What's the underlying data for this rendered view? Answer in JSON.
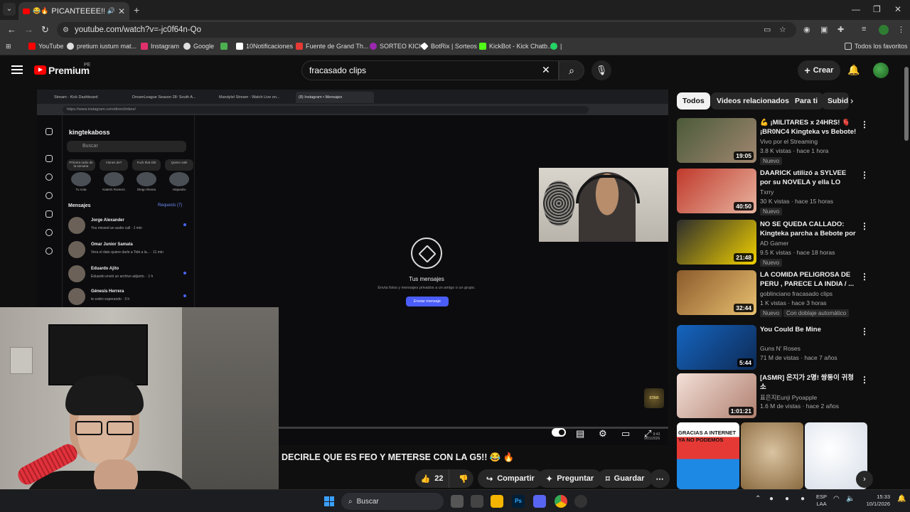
{
  "browser": {
    "tab_title": "PICANTEEEE!! KINGTE",
    "url": "youtube.com/watch?v=-jc0f64n-Qo",
    "bookmarks": [
      {
        "label": "YouTube",
        "color": "#ff0000"
      },
      {
        "label": "pretium iustum mat...",
        "color": "#e0e0e0"
      },
      {
        "label": "Instagram",
        "color": "#e1306c"
      },
      {
        "label": "Google",
        "color": "#e0e0e0"
      },
      {
        "label": "",
        "color": "#4caf50"
      },
      {
        "label": "10Notificaciones",
        "color": "#ffffff"
      },
      {
        "label": "Fuente de Grand Th...",
        "color": "#e53935"
      },
      {
        "label": "SORTEO KICK",
        "color": "#9c27b0"
      },
      {
        "label": "BotRix | Sorteos",
        "color": "#ffffff"
      },
      {
        "label": "KickBot - Kick Chatb...",
        "color": "#53fc18"
      },
      {
        "label": "|",
        "color": "#25d366"
      }
    ],
    "all_bookmarks": "Todos los favoritos"
  },
  "youtube": {
    "logo": "Premium",
    "country": "PE",
    "search_query": "fracasado clips",
    "create_label": "Crear",
    "video_title": "DECIRLE QUE ES FEO Y METERSE CON LA G5!! 😂 🔥",
    "likes": "22",
    "share_label": "Compartir",
    "ask_label": "Preguntar",
    "save_label": "Guardar"
  },
  "inner_video": {
    "tabs": [
      "Stream - Kick Dashboard",
      "DreamLeague Season 28: South A...",
      "Mandylel Stream - Watch Live on...",
      "(8) Instagram • Mensajes"
    ],
    "url": "https://www.instagram.com/direct/inbox/",
    "username": "kingtekaboss",
    "search_placeholder": "Buscar",
    "notes": [
      {
        "bubble": "Primera radio de la semana",
        "name": "Tu nota"
      },
      {
        "bubble": "Vienes de?",
        "name": "Katerin Romero"
      },
      {
        "bubble": "Fuck that shit",
        "name": "Diego Rivera"
      },
      {
        "bubble": "Quiero salir",
        "name": "Alejandro"
      }
    ],
    "messages_heading": "Mensajes",
    "requests": "Requests (7)",
    "threads": [
      {
        "name": "Jorge Alexander",
        "preview": "You missed an audio call · 1 min"
      },
      {
        "name": "Omar Junior Samata",
        "preview": "Vera el dato quiere darle a Tobi a la... · 11 min"
      },
      {
        "name": "Eduardo Ajito",
        "preview": "Eduardo envió un archivo adjunto. · 1 h"
      },
      {
        "name": "Génesis Herrera",
        "preview": "te estén esperando · 3 h"
      }
    ],
    "empty_title": "Tus mensajes",
    "empty_sub": "Envía fotos y mensajes privados a un amigo o un grupo.",
    "send_button": "Enviar mensaje",
    "badge": "STAR",
    "clock": "9:43",
    "date": "9/01/2026"
  },
  "recommendations": {
    "chips": [
      "Todos",
      "Videos relacionados",
      "Para ti",
      "Subid"
    ],
    "items": [
      {
        "title": "💪 ¡MILITARES x 24HRS! 🫀 ¡BR0NC4 Kingteka vs Bebote! ...",
        "channel": "Vivo por el Streaming",
        "meta": "3.8 K vistas · hace 1 hora",
        "badge": "Nuevo",
        "duration": "19:05",
        "c1": "#4b5a3a",
        "c2": "#a08770"
      },
      {
        "title": "DAARICK utilizó a SYLVEE por su NOVELA y ella LO EXPONE | ...",
        "channel": "Txrry",
        "meta": "30 K vistas · hace 15 horas",
        "badge": "Nuevo",
        "duration": "40:50",
        "c1": "#c0392b",
        "c2": "#e8b4a0"
      },
      {
        "title": "NO SE QUEDA CALLADO: Kingteka parcha a Bebote por l...",
        "channel": "AD Gamer",
        "meta": "9.5 K vistas · hace 18 horas",
        "badge": "Nuevo",
        "duration": "21:48",
        "c1": "#2c2c2c",
        "c2": "#f0d000"
      },
      {
        "title": "LA COMIDA PELIGROSA DE PERU , PARECE LA INDIA / ...",
        "channel": "goblinciano fracasado clips",
        "meta": "1 K vistas · hace 3 horas",
        "badge": "Nuevo",
        "badge2": "Con doblaje automático",
        "duration": "32:44",
        "c1": "#8b5a2b",
        "c2": "#e8c070"
      },
      {
        "title": "You Could Be Mine",
        "channel": "Guns N' Roses",
        "meta": "71 M de vistas · hace 7 años",
        "badge": "",
        "duration": "5:44",
        "c1": "#1565c0",
        "c2": "#0d2a55"
      },
      {
        "title": "[ASMR] 은지가 2명! 쌍둥이 귀청소",
        "channel": "표은지Eunji Pyoapple",
        "meta": "1.6 M de vistas · hace 2 años",
        "badge": "",
        "duration": "1:01:21",
        "c1": "#f3e0d8",
        "c2": "#b08070"
      }
    ],
    "shorts": [
      {
        "caption": "GRACIAS A INTERNET YA NO PODEMOS",
        "c1": "#e53935",
        "c2": "#1e88e5"
      },
      {
        "caption": "",
        "c1": "#d9c3a0",
        "c2": "#8a6a40"
      },
      {
        "caption": "",
        "c1": "#ffffff",
        "c2": "#d6dde8"
      }
    ]
  },
  "taskbar": {
    "search": "Buscar",
    "lang1": "ESP",
    "lang2": "LAA",
    "time": "15:33",
    "date": "10/1/2026"
  }
}
